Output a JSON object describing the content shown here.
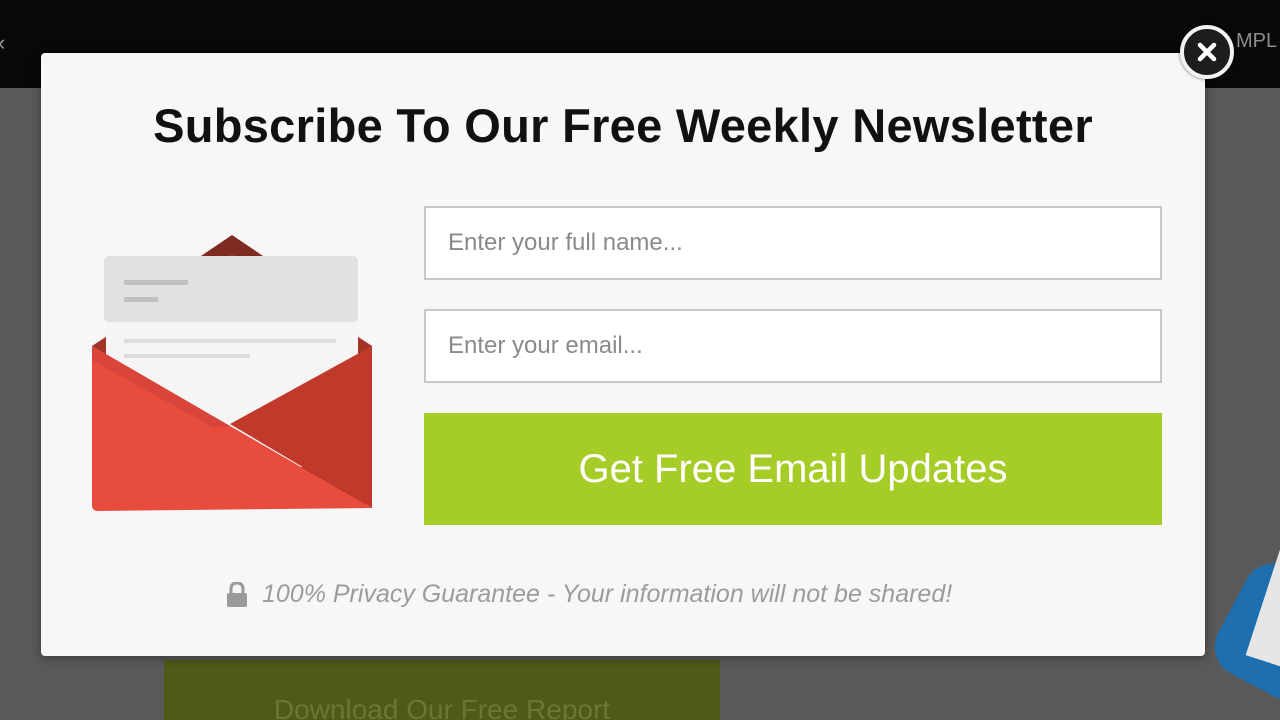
{
  "background": {
    "top_left_glyph": "‹",
    "top_right_text": "MPL",
    "download_button_label": "Download Our Free Report"
  },
  "modal": {
    "title": "Subscribe To Our Free Weekly Newsletter",
    "name_field": {
      "placeholder": "Enter your full name...",
      "value": ""
    },
    "email_field": {
      "placeholder": "Enter your email...",
      "value": ""
    },
    "submit_label": "Get Free Email Updates",
    "privacy_text": "100% Privacy Guarantee - Your information will not be shared!",
    "close_icon": "close-icon",
    "illustration_icon": "envelope-icon",
    "privacy_icon": "lock-icon"
  },
  "colors": {
    "accent_green": "#a6cc28",
    "envelope_red": "#e84c3d",
    "overlay_gray": "#595959",
    "header_black": "#080808"
  }
}
